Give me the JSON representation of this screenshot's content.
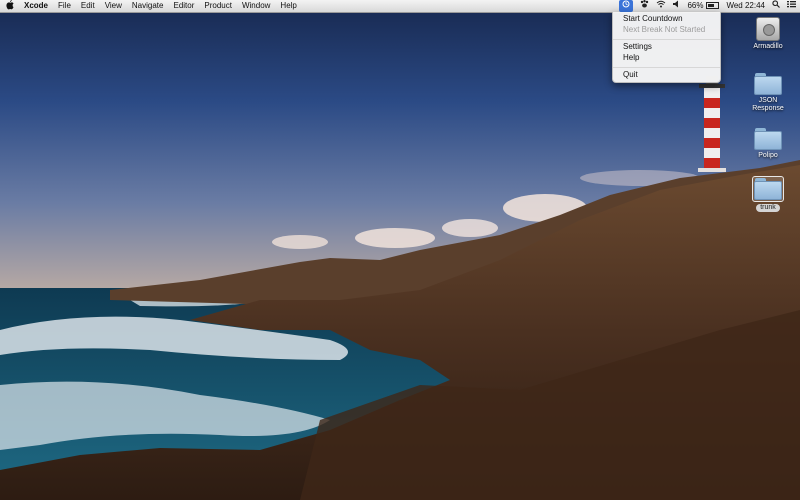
{
  "menubar": {
    "apple_icon": "apple-logo-icon",
    "app_name": "Xcode",
    "menus": [
      "File",
      "Edit",
      "View",
      "Navigate",
      "Editor",
      "Product",
      "Window",
      "Help"
    ],
    "status": {
      "active_item_icon": "timer-icon",
      "battery_percent": "66%",
      "clock": "Wed 22:44"
    }
  },
  "dropdown": {
    "start": "Start Countdown",
    "next_break": "Next Break Not Started",
    "settings": "Settings",
    "help": "Help",
    "quit": "Quit"
  },
  "desktop_icons": [
    {
      "label": "Armadillo",
      "icon": "hard-disk-icon"
    },
    {
      "label": "JSON Response",
      "icon": "folder-icon"
    },
    {
      "label": "Polipo",
      "icon": "folder-icon"
    },
    {
      "label": "trunk",
      "icon": "folder-icon"
    }
  ],
  "colors": {
    "menu_highlight": "#3a73d8",
    "sky": "#2a4478",
    "rock": "#4a3020"
  }
}
